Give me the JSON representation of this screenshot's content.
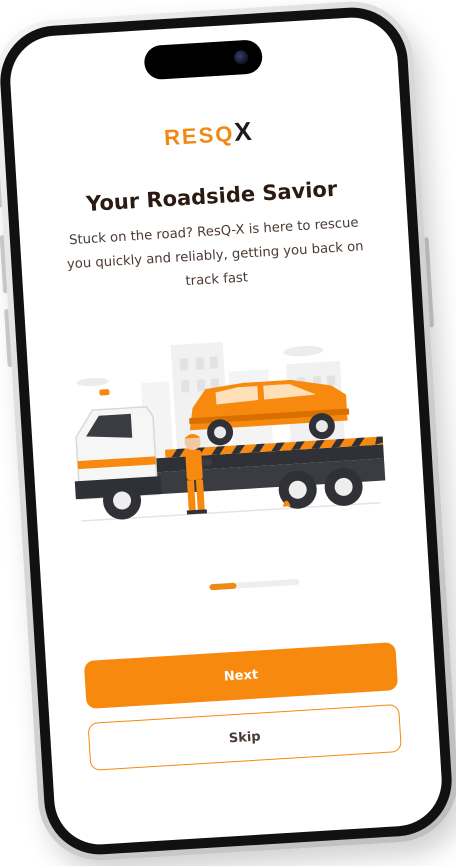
{
  "brand": {
    "logo_text": "RESQ",
    "logo_mark": "X",
    "accent_color": "#f7890f"
  },
  "onboarding": {
    "title": "Your Roadside Savior",
    "subtitle": "Stuck on the road? ResQ-X is here to rescue you quickly and reliably, getting you back on track fast",
    "illustration": "tow-truck-with-orange-suv-and-mechanic",
    "progress": 0.3
  },
  "actions": {
    "next_label": "Next",
    "skip_label": "Skip"
  }
}
